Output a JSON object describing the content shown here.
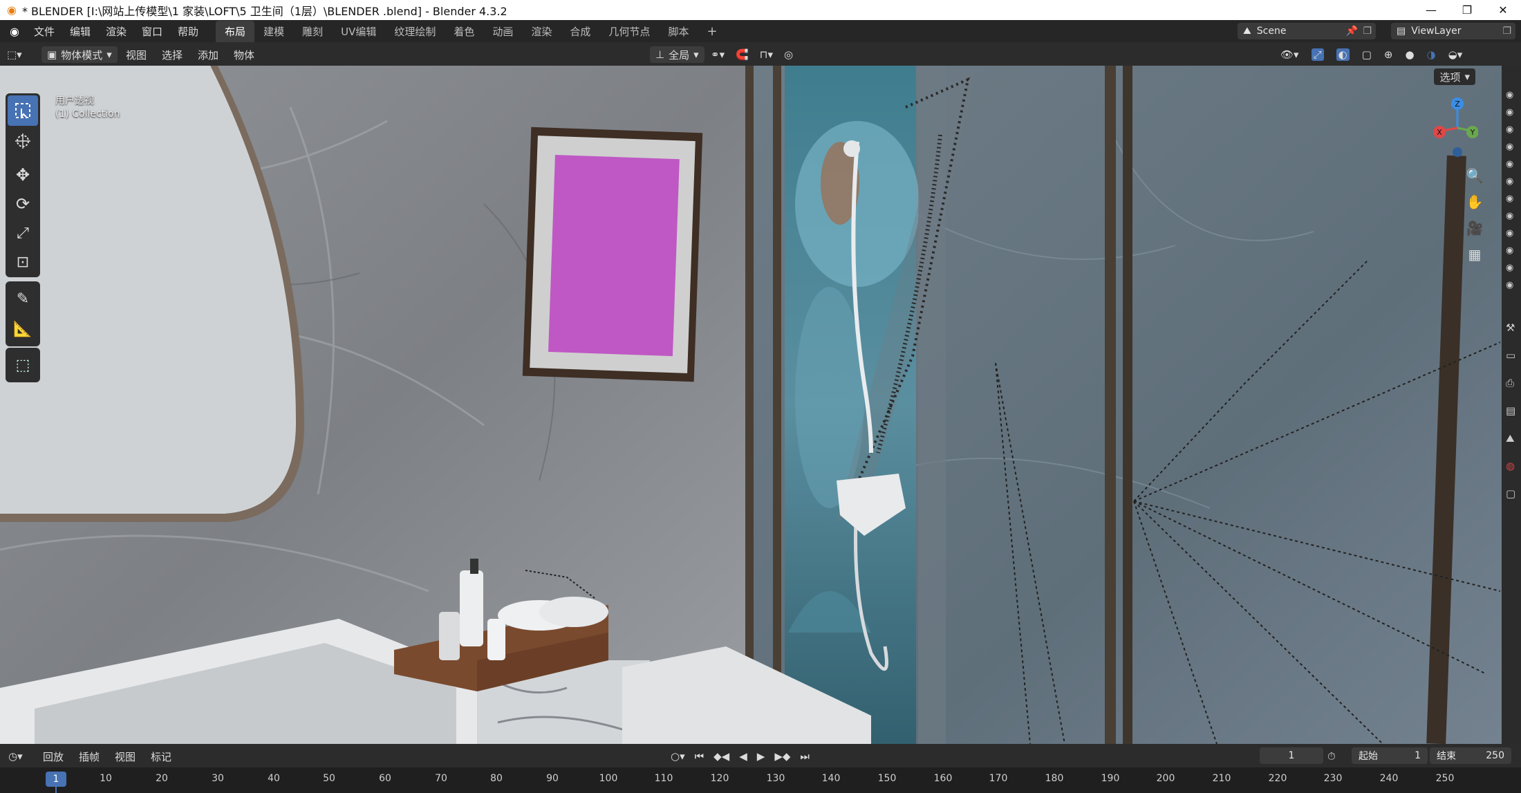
{
  "window": {
    "title": "* BLENDER [I:\\网站上传模型\\1 家装\\LOFT\\5 卫生间（1层）\\BLENDER .blend] - Blender 4.3.2"
  },
  "menus": [
    "文件",
    "编辑",
    "渲染",
    "窗口",
    "帮助"
  ],
  "workspaces": [
    "布局",
    "建模",
    "雕刻",
    "UV编辑",
    "纹理绘制",
    "着色",
    "动画",
    "渲染",
    "合成",
    "几何节点",
    "脚本"
  ],
  "active_workspace": "布局",
  "scene": {
    "name": "Scene"
  },
  "viewlayer": {
    "name": "ViewLayer"
  },
  "header": {
    "mode": "物体模式",
    "menu": [
      "视图",
      "选择",
      "添加",
      "物体"
    ],
    "orientation": "全局",
    "options": "选项"
  },
  "viewport": {
    "perspective": "用户透视",
    "collection": "(1) Collection"
  },
  "axes": {
    "x": "X",
    "y": "Y",
    "z": "Z"
  },
  "timeline": {
    "menu": [
      "回放",
      "插帧",
      "视图",
      "标记"
    ],
    "current_frame": "1",
    "start_label": "起始",
    "start": "1",
    "end_label": "结束",
    "end": "250",
    "ticks": [
      "1",
      "10",
      "20",
      "30",
      "40",
      "50",
      "60",
      "70",
      "80",
      "90",
      "100",
      "110",
      "120",
      "130",
      "140",
      "150",
      "160",
      "170",
      "180",
      "190",
      "200",
      "210",
      "220",
      "230",
      "240",
      "250"
    ]
  },
  "icons": [
    "blender-logo-icon",
    "minimize-icon",
    "maximize-icon",
    "close-icon",
    "select-box-icon",
    "cursor-icon",
    "move-icon",
    "rotate-icon",
    "scale-icon",
    "transform-icon",
    "annotate-icon",
    "measure-icon",
    "add-cube-icon",
    "zoom-icon",
    "hand-icon",
    "camera-icon",
    "grid-icon",
    "play-icon"
  ],
  "colors": {
    "accent": "#4772b3",
    "axis_x": "#e04747",
    "axis_y": "#6aa84f",
    "axis_z": "#3a8ee6"
  }
}
